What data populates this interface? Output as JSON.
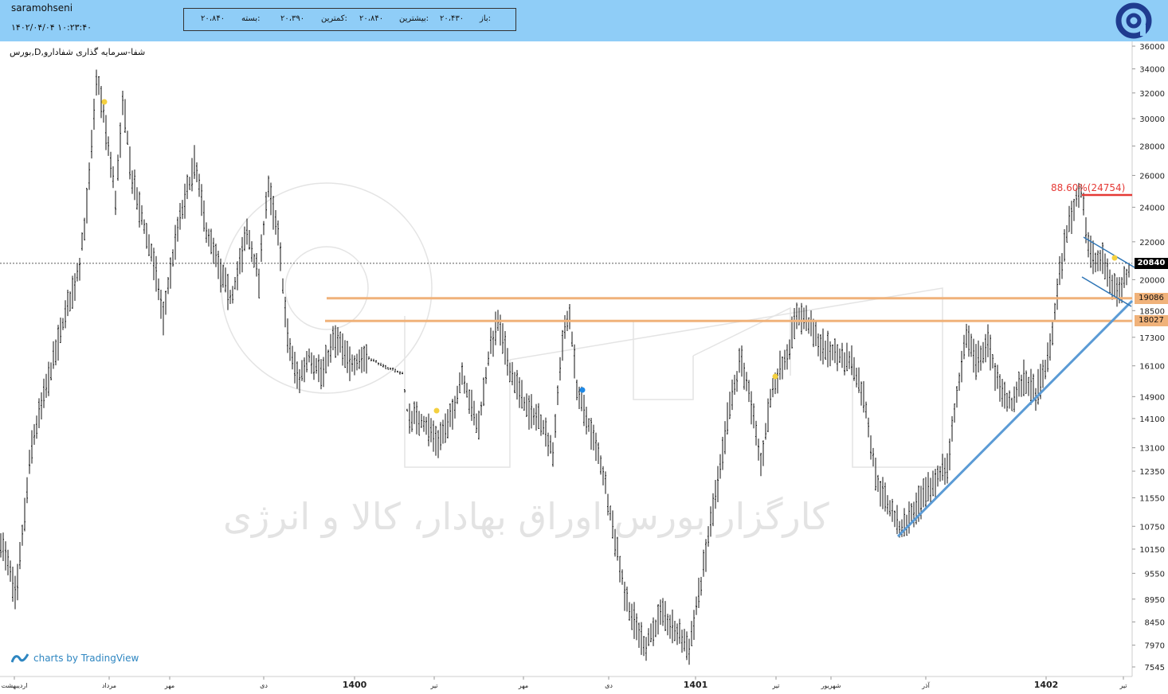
{
  "header": {
    "username": "saramohseni",
    "datetime": "۱۴۰۲/۰۴/۰۴ ۱۰:۲۳:۴۰",
    "ohlc": [
      {
        "label": "باز:",
        "value": "۲۰،۴۳۰"
      },
      {
        "label": "بیشترین:",
        "value": "۲۰،۸۴۰"
      },
      {
        "label": "کمترین:",
        "value": "۲۰،۳۹۰"
      },
      {
        "label": "بسته:",
        "value": "۲۰،۸۴۰"
      }
    ]
  },
  "symbol_title": "بورس,D,شفا-سرمایه گذاری شفادارو",
  "branding": "charts by TradingView",
  "watermark": "کارگزار بورس اوراق بهادار، کالا و انرژی",
  "colors": {
    "header_bg": "#8fcdf7",
    "support": "#f0b27a",
    "resistance_red": "#e53935",
    "trendline": "#5b9bd5",
    "last_price_bg": "#000000",
    "marker_yellow": "#f4d03f",
    "marker_blue": "#1e88e5"
  },
  "chart_data": {
    "type": "bar",
    "scale": "log",
    "y_ticks": [
      "36000",
      "34000",
      "32000",
      "30000",
      "28000",
      "26000",
      "24000",
      "22000",
      "20000",
      "18500",
      "17300",
      "16100",
      "14900",
      "14100",
      "13100",
      "12350",
      "11550",
      "10750",
      "10150",
      "9550",
      "8950",
      "8450",
      "7970",
      "7545"
    ],
    "x_ticks": [
      "اردیبهشت",
      "مرداد",
      "مهر",
      "دی",
      "1400",
      "تیر",
      "مهر",
      "دی",
      "1401",
      "تیر",
      "شهریور",
      "آذر",
      "1402",
      "تیر"
    ],
    "last_price": "20840",
    "levels": [
      {
        "label": "19086",
        "value": 19086,
        "color": "#f0b27a"
      },
      {
        "label": "18027",
        "value": 18027,
        "color": "#f0b27a"
      }
    ],
    "fib_level": {
      "label": "88.60%(24754)",
      "value": 24754
    },
    "series_path": [
      [
        0,
        10500
      ],
      [
        20,
        9000
      ],
      [
        40,
        13200
      ],
      [
        60,
        15500
      ],
      [
        80,
        18000
      ],
      [
        100,
        20800
      ],
      [
        110,
        24500
      ],
      [
        122,
        33500
      ],
      [
        132,
        29500
      ],
      [
        145,
        24500
      ],
      [
        155,
        31500
      ],
      [
        165,
        26000
      ],
      [
        180,
        23000
      ],
      [
        195,
        20500
      ],
      [
        205,
        18200
      ],
      [
        222,
        22500
      ],
      [
        244,
        26800
      ],
      [
        260,
        22500
      ],
      [
        275,
        20500
      ],
      [
        290,
        19000
      ],
      [
        310,
        22500
      ],
      [
        325,
        20000
      ],
      [
        336,
        25500
      ],
      [
        350,
        22000
      ],
      [
        362,
        17000
      ],
      [
        375,
        15500
      ],
      [
        388,
        16500
      ],
      [
        405,
        15800
      ],
      [
        420,
        17300
      ],
      [
        440,
        16200
      ],
      [
        460,
        16500
      ],
      [
        480,
        16100
      ],
      [
        505,
        15800
      ],
      [
        512,
        14200
      ],
      [
        530,
        14000
      ],
      [
        550,
        13400
      ],
      [
        565,
        14000
      ],
      [
        580,
        15800
      ],
      [
        600,
        13700
      ],
      [
        615,
        16800
      ],
      [
        625,
        18000
      ],
      [
        640,
        16000
      ],
      [
        660,
        14500
      ],
      [
        680,
        14000
      ],
      [
        695,
        12900
      ],
      [
        705,
        17000
      ],
      [
        715,
        18300
      ],
      [
        725,
        15000
      ],
      [
        740,
        13800
      ],
      [
        755,
        12500
      ],
      [
        770,
        10700
      ],
      [
        785,
        9000
      ],
      [
        800,
        8300
      ],
      [
        810,
        7950
      ],
      [
        830,
        8600
      ],
      [
        850,
        8200
      ],
      [
        865,
        7950
      ],
      [
        880,
        9300
      ],
      [
        895,
        11300
      ],
      [
        905,
        12500
      ],
      [
        915,
        14500
      ],
      [
        925,
        15500
      ],
      [
        930,
        16600
      ],
      [
        945,
        14200
      ],
      [
        955,
        12500
      ],
      [
        965,
        14500
      ],
      [
        975,
        15700
      ],
      [
        990,
        16800
      ],
      [
        1000,
        18400
      ],
      [
        1012,
        18000
      ],
      [
        1030,
        17000
      ],
      [
        1050,
        16500
      ],
      [
        1070,
        16300
      ],
      [
        1085,
        14800
      ],
      [
        1100,
        12100
      ],
      [
        1115,
        11300
      ],
      [
        1130,
        10650
      ],
      [
        1145,
        11100
      ],
      [
        1160,
        11600
      ],
      [
        1180,
        12300
      ],
      [
        1190,
        12600
      ],
      [
        1200,
        14700
      ],
      [
        1213,
        17500
      ],
      [
        1225,
        16300
      ],
      [
        1240,
        17100
      ],
      [
        1255,
        15100
      ],
      [
        1270,
        14600
      ],
      [
        1285,
        15600
      ],
      [
        1300,
        15000
      ],
      [
        1315,
        16300
      ],
      [
        1322,
        17800
      ],
      [
        1330,
        20300
      ],
      [
        1340,
        22800
      ],
      [
        1350,
        24300
      ],
      [
        1358,
        25200
      ],
      [
        1365,
        22000
      ],
      [
        1375,
        20800
      ],
      [
        1385,
        21000
      ],
      [
        1395,
        19800
      ],
      [
        1405,
        19400
      ],
      [
        1412,
        20000
      ],
      [
        1418,
        20500
      ]
    ]
  }
}
